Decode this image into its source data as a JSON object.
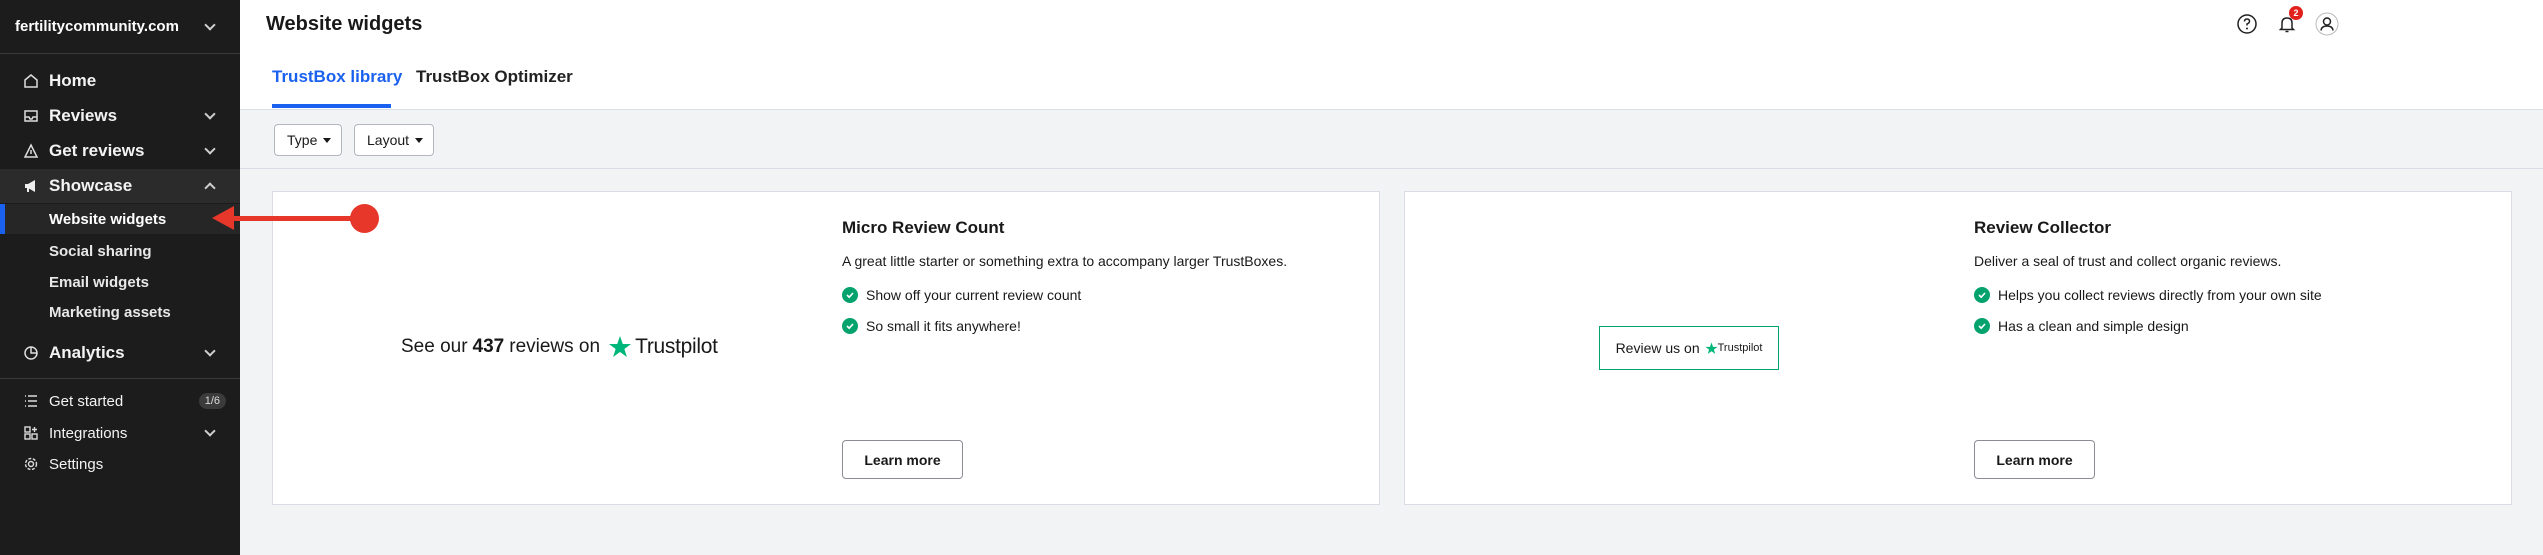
{
  "sidebar": {
    "domain": "fertilitycommunity.com",
    "items": {
      "home": "Home",
      "reviews": "Reviews",
      "get_reviews": "Get reviews",
      "showcase": "Showcase",
      "analytics": "Analytics",
      "get_started": "Get started",
      "get_started_progress": "1/6",
      "integrations": "Integrations",
      "settings": "Settings"
    },
    "showcase_sub": {
      "website_widgets": "Website widgets",
      "social_sharing": "Social sharing",
      "email_widgets": "Email widgets",
      "marketing_assets": "Marketing assets"
    }
  },
  "header": {
    "title": "Website widgets",
    "tabs": {
      "library": "TrustBox library",
      "optimizer": "TrustBox Optimizer"
    },
    "notifications_count": "2"
  },
  "filters": {
    "type": "Type",
    "layout": "Layout"
  },
  "cards": [
    {
      "title": "Micro Review Count",
      "description": "A great little starter or something extra to accompany larger TrustBoxes.",
      "features": [
        "Show off your current review count",
        "So small it fits anywhere!"
      ],
      "button": "Learn more",
      "preview": {
        "prefix": "See our",
        "count": "437",
        "suffix": "reviews on",
        "brand": "Trustpilot"
      }
    },
    {
      "title": "Review Collector",
      "description": "Deliver a seal of trust and collect organic reviews.",
      "features": [
        "Helps you collect reviews directly from your own site",
        "Has a clean and simple design"
      ],
      "button": "Learn more",
      "preview": {
        "text": "Review us on",
        "brand": "Trustpilot"
      }
    }
  ],
  "colors": {
    "accent": "#1b61f0",
    "trustpilot_green": "#00b67a",
    "check_green": "#04a26c",
    "annotation": "#e7372a",
    "sidebar_bg": "#1c1c1c"
  }
}
